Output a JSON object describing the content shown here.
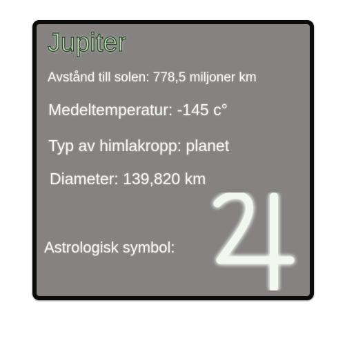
{
  "card": {
    "title": "Jupiter",
    "distance": "Avstånd till solen: 778,5 miljoner km",
    "temperature": "Medeltemperatur: -145 c°",
    "type": "Typ av himlakropp: planet",
    "diameter": "Diameter: 139,820 km",
    "symbol_label": "Astrologisk symbol:",
    "symbol_icon": "jupiter-symbol-icon"
  },
  "colors": {
    "card_background": "#858281",
    "card_border": "#0b0b0b",
    "title_fill": "#b7dcb0",
    "text": "#f4f4f4"
  }
}
